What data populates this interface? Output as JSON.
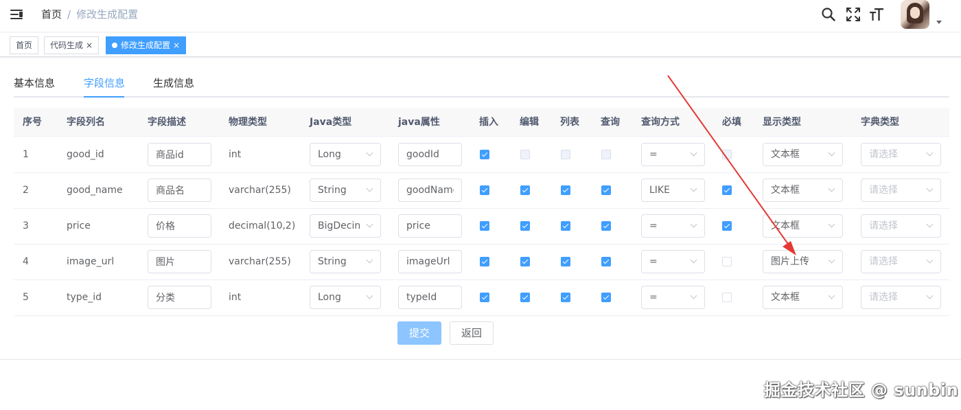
{
  "header": {
    "breadcrumb": {
      "home": "首页",
      "separator": "/",
      "current": "修改生成配置"
    }
  },
  "tags": [
    {
      "label": "首页",
      "active": false
    },
    {
      "label": "代码生成",
      "active": false,
      "close": "×"
    },
    {
      "label": "修改生成配置",
      "active": true,
      "close": "×"
    }
  ],
  "tabs": [
    {
      "label": "基本信息",
      "active": false
    },
    {
      "label": "字段信息",
      "active": true
    },
    {
      "label": "生成信息",
      "active": false
    }
  ],
  "table": {
    "columns": [
      "序号",
      "字段列名",
      "字段描述",
      "物理类型",
      "Java类型",
      "java属性",
      "插入",
      "编辑",
      "列表",
      "查询",
      "查询方式",
      "必填",
      "显示类型",
      "字典类型"
    ],
    "rows": [
      {
        "index": "1",
        "column": "good_id",
        "desc": "商品id",
        "physical": "int",
        "java_type": "Long",
        "java_field": "goodId",
        "insert": true,
        "edit": false,
        "list": false,
        "query": false,
        "query_type": "=",
        "required": false,
        "display": "文本框",
        "dict": "请选择",
        "pk": true
      },
      {
        "index": "2",
        "column": "good_name",
        "desc": "商品名",
        "physical": "varchar(255)",
        "java_type": "String",
        "java_field": "goodName",
        "insert": true,
        "edit": true,
        "list": true,
        "query": true,
        "query_type": "LIKE",
        "required": true,
        "display": "文本框",
        "dict": "请选择",
        "pk": false
      },
      {
        "index": "3",
        "column": "price",
        "desc": "价格",
        "physical": "decimal(10,2)",
        "java_type": "BigDecin",
        "java_field": "price",
        "insert": true,
        "edit": true,
        "list": true,
        "query": true,
        "query_type": "=",
        "required": true,
        "display": "文本框",
        "dict": "请选择",
        "pk": false
      },
      {
        "index": "4",
        "column": "image_url",
        "desc": "图片",
        "physical": "varchar(255)",
        "java_type": "String",
        "java_field": "imageUrl",
        "insert": true,
        "edit": true,
        "list": true,
        "query": true,
        "query_type": "=",
        "required": false,
        "display": "图片上传",
        "dict": "请选择",
        "pk": false
      },
      {
        "index": "5",
        "column": "type_id",
        "desc": "分类",
        "physical": "int",
        "java_type": "Long",
        "java_field": "typeId",
        "insert": true,
        "edit": true,
        "list": true,
        "query": true,
        "query_type": "=",
        "required": false,
        "display": "文本框",
        "dict": "请选择",
        "pk": false
      }
    ]
  },
  "actions": {
    "submit": "提交",
    "back": "返回"
  },
  "watermark": "掘金技术社区 @ sunbin",
  "colors": {
    "primary": "#409eff",
    "submit_disabled": "#8cc5ff",
    "annotation_arrow": "#e53935"
  }
}
